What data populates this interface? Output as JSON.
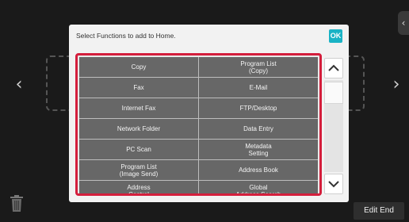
{
  "dialog": {
    "title": "Select Functions to add to Home.",
    "ok_label": "OK"
  },
  "functions": [
    "Copy",
    "Program List\n(Copy)",
    "Fax",
    "E-Mail",
    "Internet Fax",
    "FTP/Desktop",
    "Network Folder",
    "Data Entry",
    "PC Scan",
    "Metadata\nSetting",
    "Program List\n(Image Send)",
    "Address Book",
    "Address\nControl",
    "Global\nAddress Search"
  ],
  "footer": {
    "edit_end_label": "Edit End"
  },
  "icons": {
    "prev": "chevron-left-icon",
    "next": "chevron-right-icon",
    "side_tab": "chevron-left-small-icon",
    "trash": "trash-icon",
    "scroll_up": "chevron-up-icon",
    "scroll_down": "chevron-down-icon"
  },
  "colors": {
    "accent": "#1ab3c5",
    "highlight": "#d41e3c",
    "button": "#676767"
  }
}
